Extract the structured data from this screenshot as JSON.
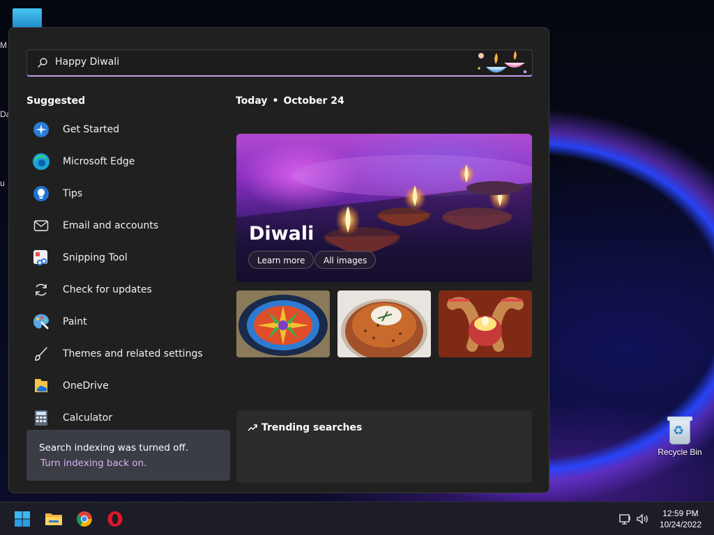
{
  "desktop": {
    "clipped_labels": [
      "M",
      "Da",
      "u"
    ],
    "recycle_bin_label": "Recycle Bin"
  },
  "search": {
    "value": "Happy Diwali",
    "placeholder": ""
  },
  "suggested": {
    "title": "Suggested",
    "items": [
      {
        "label": "Get Started",
        "icon": "get-started-icon"
      },
      {
        "label": "Microsoft Edge",
        "icon": "edge-icon"
      },
      {
        "label": "Tips",
        "icon": "tips-icon"
      },
      {
        "label": "Email and accounts",
        "icon": "mail-icon"
      },
      {
        "label": "Snipping Tool",
        "icon": "snipping-tool-icon"
      },
      {
        "label": "Check for updates",
        "icon": "refresh-icon"
      },
      {
        "label": "Paint",
        "icon": "paint-icon"
      },
      {
        "label": "Themes and related settings",
        "icon": "brush-icon"
      },
      {
        "label": "OneDrive",
        "icon": "onedrive-icon"
      },
      {
        "label": "Calculator",
        "icon": "calculator-icon"
      }
    ]
  },
  "toast": {
    "message": "Search indexing was turned off.",
    "link": "Turn indexing back on."
  },
  "today": {
    "label": "Today",
    "date": "October 24"
  },
  "hero": {
    "title": "Diwali",
    "learn_more": "Learn more",
    "all_images": "All images"
  },
  "trending": {
    "title": "Trending searches"
  },
  "taskbar": {
    "apps": [
      "start-icon",
      "file-explorer-icon",
      "chrome-icon",
      "opera-icon"
    ],
    "time": "12:59 PM",
    "date": "10/24/2022"
  },
  "colors": {
    "accent": "#c99be7",
    "link": "#d7b3f2",
    "panel_bg": "#202020"
  }
}
